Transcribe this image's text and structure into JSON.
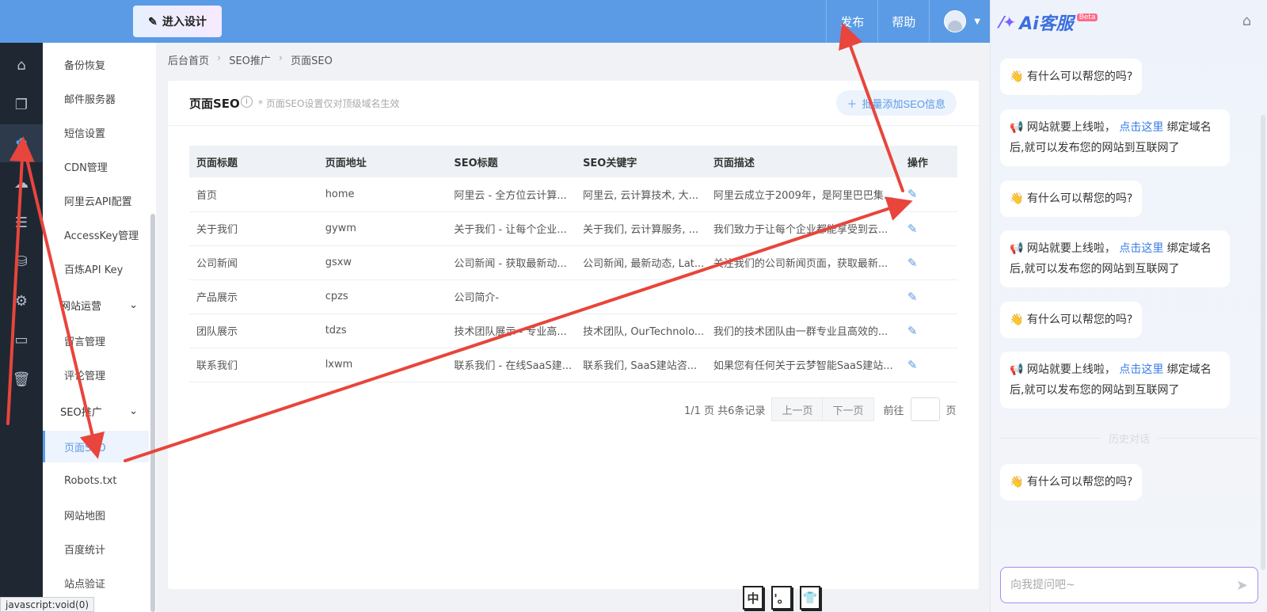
{
  "topbar": {
    "design_btn": "进入设计",
    "publish": "发布",
    "help": "帮助"
  },
  "submenu": {
    "items": [
      "备份恢复",
      "邮件服务器",
      "短信设置",
      "CDN管理",
      "阿里云API配置",
      "AccessKey管理",
      "百炼API Key"
    ],
    "group_ops": "网站运营",
    "ops_items": [
      "留言管理",
      "评论管理"
    ],
    "group_seo": "SEO推广",
    "seo_items": [
      "页面SEO",
      "Robots.txt",
      "网站地图",
      "百度统计",
      "站点验证"
    ]
  },
  "breadcrumb": [
    "后台首页",
    "SEO推广",
    "页面SEO"
  ],
  "card": {
    "title": "页面SEO",
    "tip": "* 页面SEO设置仅对顶级域名生效",
    "batch_btn": "批量添加SEO信息"
  },
  "table": {
    "headers": [
      "页面标题",
      "页面地址",
      "SEO标题",
      "SEO关键字",
      "页面描述",
      "操作"
    ],
    "rows": [
      [
        "首页",
        "home",
        "阿里云 - 全方位云计算...",
        "阿里云, 云计算技术, 大...",
        "阿里云成立于2009年，是阿里巴巴集..."
      ],
      [
        "关于我们",
        "gywm",
        "关于我们 - 让每个企业...",
        "关于我们, 云计算服务, ...",
        "我们致力于让每个企业都能享受到云..."
      ],
      [
        "公司新闻",
        "gsxw",
        "公司新闻 - 获取最新动...",
        "公司新闻, 最新动态, Lat...",
        "关注我们的公司新闻页面，获取最新..."
      ],
      [
        "产品展示",
        "cpzs",
        "公司简介-",
        "",
        ""
      ],
      [
        "团队展示",
        "tdzs",
        "技术团队展示 - 专业高...",
        "技术团队, OurTechnolo...",
        "我们的技术团队由一群专业且高效的..."
      ],
      [
        "联系我们",
        "lxwm",
        "联系我们 - 在线SaaS建...",
        "联系我们, SaaS建站咨...",
        "如果您有任何关于云梦智能SaaS建站..."
      ]
    ]
  },
  "pager": {
    "info": "1/1 页 共6条记录",
    "prev": "上一页",
    "next": "下一页",
    "goto": "前往",
    "page": "页"
  },
  "ime": [
    "中",
    "'。",
    "👕"
  ],
  "status": "javascript:void(0)",
  "ai": {
    "logo": "Ai客服",
    "beta": "Beta",
    "greeting": "有什么可以帮您的吗?",
    "launch_pre": "网站就要上线啦，",
    "launch_link": "点击这里",
    "launch_post": "绑定域名后,就可以发布您的网站到互联网了",
    "history": "历史对话",
    "input_placeholder": "向我提问吧~"
  },
  "colors": {
    "brand": "#5b9be6",
    "rail": "#1f2733",
    "annotation": "#e8453c"
  }
}
